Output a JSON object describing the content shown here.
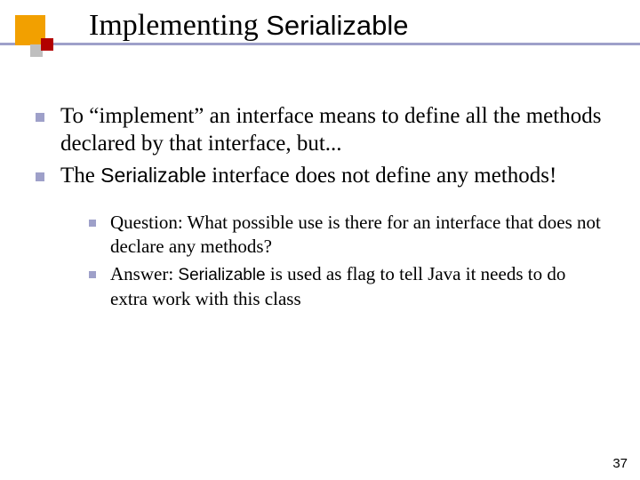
{
  "header": {
    "title_plain": "Implementing ",
    "title_code": "Serializable"
  },
  "bullets": [
    {
      "parts": [
        {
          "t": "To “implement” an interface means to define all the methods declared by that interface, but...",
          "code": false
        }
      ]
    },
    {
      "parts": [
        {
          "t": "The ",
          "code": false
        },
        {
          "t": "Serializable",
          "code": true
        },
        {
          "t": " interface does not define any methods!",
          "code": false
        }
      ]
    }
  ],
  "subbullets": [
    {
      "parts": [
        {
          "t": "Question: What possible use is there for an interface that does not declare any methods?",
          "code": false
        }
      ]
    },
    {
      "parts": [
        {
          "t": "Answer: ",
          "code": false
        },
        {
          "t": "Serializable",
          "code": true
        },
        {
          "t": " is used as flag to tell Java it needs to do extra work with this class",
          "code": false
        }
      ]
    }
  ],
  "page_number": "37"
}
